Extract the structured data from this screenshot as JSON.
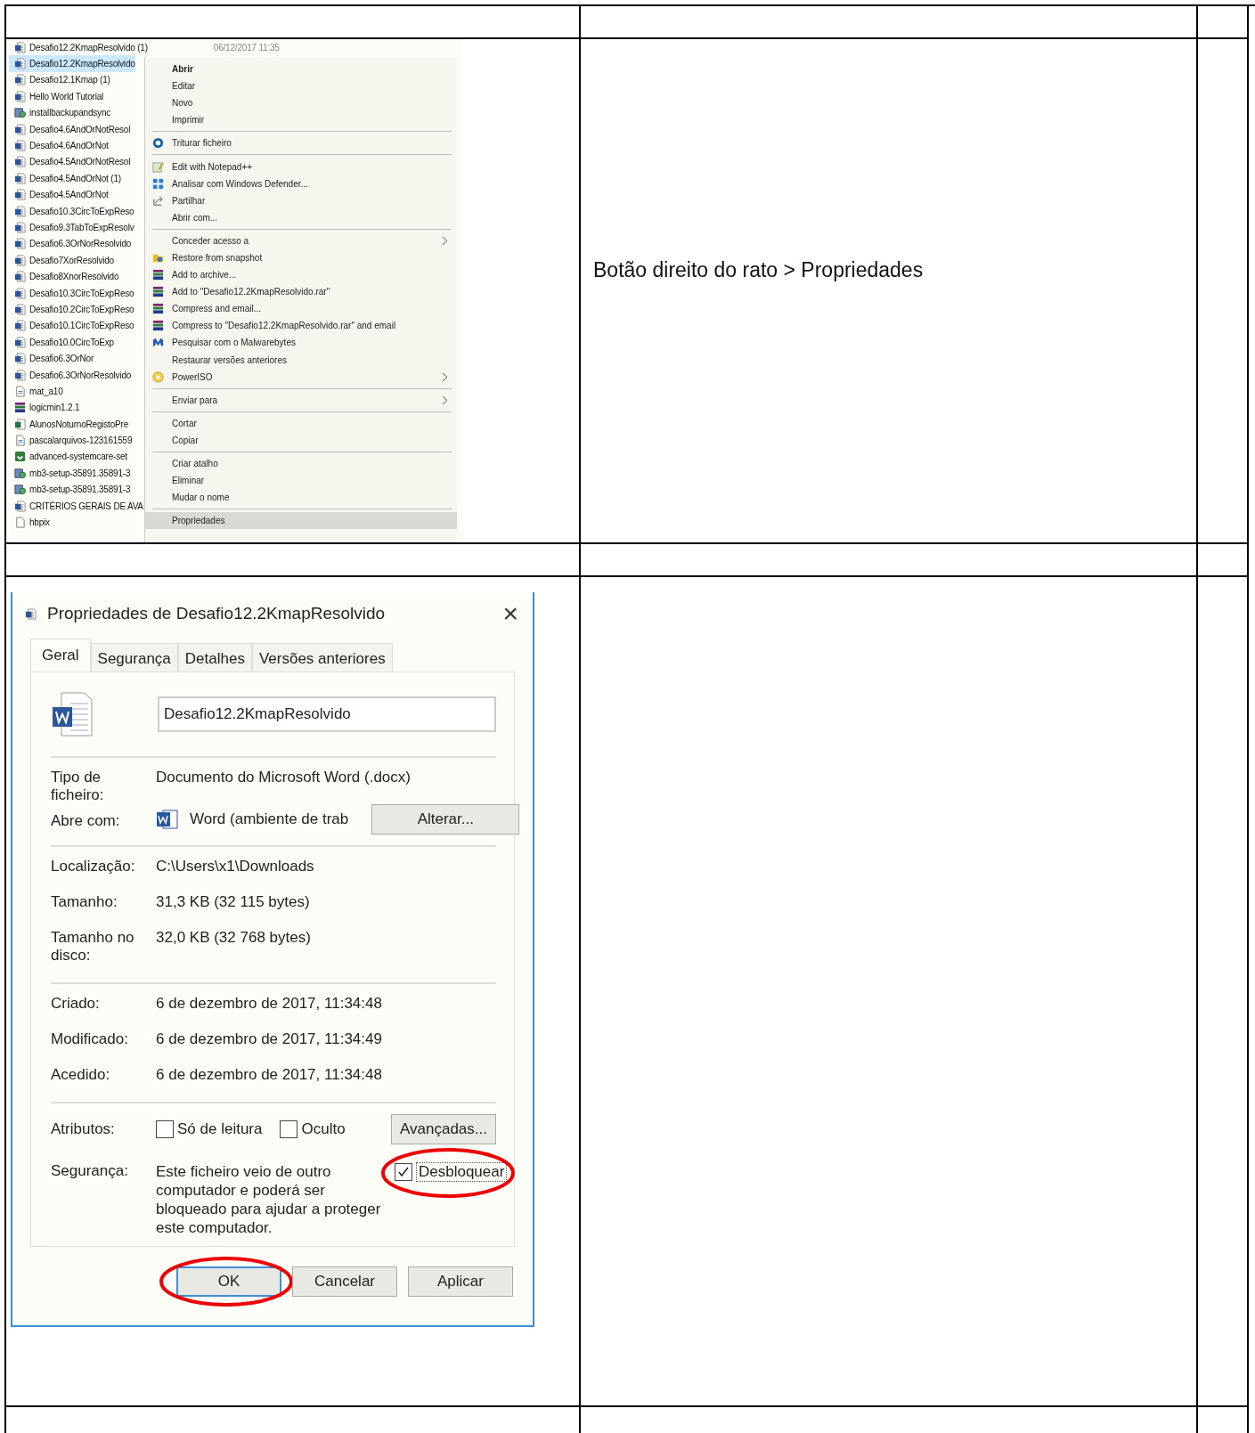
{
  "explorer": {
    "files": [
      {
        "name": "Desafio12.2KmapResolvido (1)",
        "date": "06/12/2017 11:35",
        "kind": "word",
        "selected": false
      },
      {
        "name": "Desafio12.2KmapResolvido",
        "kind": "word",
        "selected": true
      },
      {
        "name": "Desafio12.1Kmap (1)",
        "kind": "word",
        "selected": false
      },
      {
        "name": "Hello World Tutorial",
        "kind": "word",
        "selected": false
      },
      {
        "name": "installbackupandsync",
        "kind": "setup",
        "selected": false
      },
      {
        "name": "Desafio4.6AndOrNotResol",
        "kind": "word",
        "selected": false
      },
      {
        "name": "Desafio4.6AndOrNot",
        "kind": "word",
        "selected": false
      },
      {
        "name": "Desafio4.5AndOrNotResol",
        "kind": "word",
        "selected": false
      },
      {
        "name": "Desafio4.5AndOrNot (1)",
        "kind": "word",
        "selected": false
      },
      {
        "name": "Desafio4.5AndOrNot",
        "kind": "word",
        "selected": false
      },
      {
        "name": "Desafio10.3CircToExpReso",
        "kind": "word",
        "selected": false
      },
      {
        "name": "Desafio9.3TabToExpResolv",
        "kind": "word",
        "selected": false
      },
      {
        "name": "Desafio6.3OrNorResolvido",
        "kind": "word",
        "selected": false
      },
      {
        "name": "Desafio7XorResolvido",
        "kind": "word",
        "selected": false
      },
      {
        "name": "Desafio8XnorResolvido",
        "kind": "word",
        "selected": false
      },
      {
        "name": "Desafio10.3CircToExpReso",
        "kind": "word",
        "selected": false
      },
      {
        "name": "Desafio10.2CircToExpReso",
        "kind": "word",
        "selected": false
      },
      {
        "name": "Desafio10.1CircToExpReso",
        "kind": "word",
        "selected": false
      },
      {
        "name": "Desafio10.0CircToExp",
        "kind": "word",
        "selected": false
      },
      {
        "name": "Desafio6.3OrNor",
        "kind": "word",
        "selected": false
      },
      {
        "name": "Desafio6.3OrNorResolvido",
        "kind": "word",
        "selected": false
      },
      {
        "name": "mat_a10",
        "kind": "text",
        "selected": false
      },
      {
        "name": "logicmin1.2.1",
        "kind": "rar",
        "selected": false
      },
      {
        "name": "AlunosNoturnoRegistoPre",
        "kind": "excel",
        "selected": false
      },
      {
        "name": "pascalarquivos-123161559",
        "kind": "text",
        "selected": false
      },
      {
        "name": "advanced-systemcare-set",
        "kind": "app",
        "selected": false
      },
      {
        "name": "mb3-setup-35891.35891-3",
        "kind": "setup",
        "selected": false
      },
      {
        "name": "mb3-setup-35891.35891-3",
        "kind": "setup",
        "selected": false
      },
      {
        "name": "CRITÉRIOS GERAIS DE AVA",
        "kind": "word",
        "selected": false
      },
      {
        "name": "hbpix",
        "kind": "blank",
        "selected": false
      }
    ],
    "context_menu": [
      {
        "items": [
          {
            "label": "Abrir",
            "default": true,
            "selected": false
          },
          {
            "label": "Editar",
            "selected": false
          },
          {
            "label": "Novo",
            "selected": false
          },
          {
            "label": "Imprimir",
            "selected": false
          }
        ]
      },
      {
        "items": [
          {
            "label": "Triturar ficheiro",
            "kind": "shred",
            "selected": false
          }
        ]
      },
      {
        "items": [
          {
            "label": "Edit with Notepad++",
            "kind": "notepad",
            "selected": false
          },
          {
            "label": "Analisar com Windows Defender...",
            "kind": "defender",
            "selected": false
          },
          {
            "label": "Partilhar",
            "kind": "share",
            "selected": false
          },
          {
            "label": "Abrir com...",
            "selected": false
          }
        ]
      },
      {
        "items": [
          {
            "label": "Conceder acesso a",
            "submenu": true,
            "selected": false
          },
          {
            "label": "Restore from snapshot",
            "kind": "folder",
            "selected": false
          },
          {
            "label": "Add to archive...",
            "kind": "rar",
            "selected": false
          },
          {
            "label": "Add to \"Desafio12.2KmapResolvido.rar\"",
            "kind": "rar",
            "selected": false
          },
          {
            "label": "Compress and email...",
            "kind": "rar",
            "selected": false
          },
          {
            "label": "Compress to \"Desafio12.2KmapResolvido.rar\" and email",
            "kind": "rar",
            "selected": false
          },
          {
            "label": "Pesquisar com o Malwarebytes",
            "kind": "malware",
            "selected": false
          },
          {
            "label": "Restaurar versões anteriores",
            "selected": false
          },
          {
            "label": "PowerISO",
            "kind": "disc",
            "submenu": true,
            "selected": false
          }
        ]
      },
      {
        "items": [
          {
            "label": "Enviar para",
            "submenu": true,
            "selected": false
          }
        ]
      },
      {
        "items": [
          {
            "label": "Cortar",
            "selected": false
          },
          {
            "label": "Copiar",
            "selected": false
          }
        ]
      },
      {
        "items": [
          {
            "label": "Criar atalho",
            "selected": false
          },
          {
            "label": "Eliminar",
            "selected": false
          },
          {
            "label": "Mudar o nome",
            "selected": false
          }
        ]
      },
      {
        "items": [
          {
            "label": "Propriedades",
            "selected": true
          }
        ]
      }
    ]
  },
  "instruction": "Botão direito do rato > Propriedades",
  "dialog": {
    "title": "Propriedades de Desafio12.2KmapResolvido",
    "close": "×",
    "tabs": [
      {
        "label": "Geral",
        "selected": true
      },
      {
        "label": "Segurança",
        "selected": false
      },
      {
        "label": "Detalhes",
        "selected": false
      },
      {
        "label": "Versões anteriores",
        "selected": false
      }
    ],
    "filename": "Desafio12.2KmapResolvido",
    "type_label": "Tipo de ficheiro:",
    "type_value": "Documento do Microsoft Word (.docx)",
    "opens_label": "Abre com:",
    "opens_value": "Word (ambiente de trab",
    "change_button": "Alterar...",
    "info_groups": [
      [
        {
          "label": "Localização:",
          "value": "C:\\Users\\x1\\Downloads"
        },
        {
          "label": "Tamanho:",
          "value": "31,3 KB (32 115 bytes)"
        },
        {
          "label": "Tamanho no disco:",
          "value": "32,0 KB (32 768 bytes)"
        }
      ],
      [
        {
          "label": "Criado:",
          "value": "6 de dezembro de 2017, 11:34:48"
        },
        {
          "label": "Modificado:",
          "value": "6 de dezembro de 2017, 11:34:49"
        },
        {
          "label": "Acedido:",
          "value": "6 de dezembro de 2017, 11:34:48"
        }
      ]
    ],
    "attributes_label": "Atributos:",
    "attributes": [
      {
        "label": "Só de leitura",
        "checked": false
      },
      {
        "label": "Oculto",
        "checked": false
      }
    ],
    "advanced_button": "Avançadas...",
    "security_label": "Segurança:",
    "security_text": "Este ficheiro veio de outro computador e poderá ser bloqueado para ajudar a proteger este computador.",
    "unblock": {
      "label": "Desbloquear",
      "checked": true,
      "circled": true
    },
    "buttons": [
      {
        "label": "OK",
        "default": true,
        "circled": true
      },
      {
        "label": "Cancelar",
        "default": false,
        "circled": false
      },
      {
        "label": "Aplicar",
        "default": false,
        "circled": false
      }
    ]
  }
}
